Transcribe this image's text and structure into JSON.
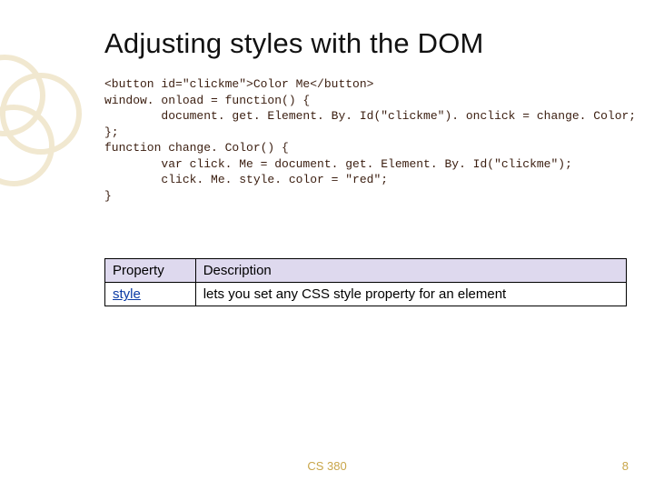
{
  "title": "Adjusting styles with the DOM",
  "code": {
    "l1": "<button id=\"clickme\">Color Me</button>",
    "l2": "window. onload = function() {",
    "l3": "        document. get. Element. By. Id(\"clickme\"). onclick = change. Color;",
    "l4": "};",
    "l5": "function change. Color() {",
    "l6": "        var click. Me = document. get. Element. By. Id(\"clickme\");",
    "l7": "        click. Me. style. color = \"red\";",
    "l8": "}"
  },
  "table": {
    "head_prop": "Property",
    "head_desc": "Description",
    "row_prop": "style",
    "row_desc": "lets you set any CSS style property for an element"
  },
  "footer": {
    "course": "CS 380",
    "page": "8"
  }
}
